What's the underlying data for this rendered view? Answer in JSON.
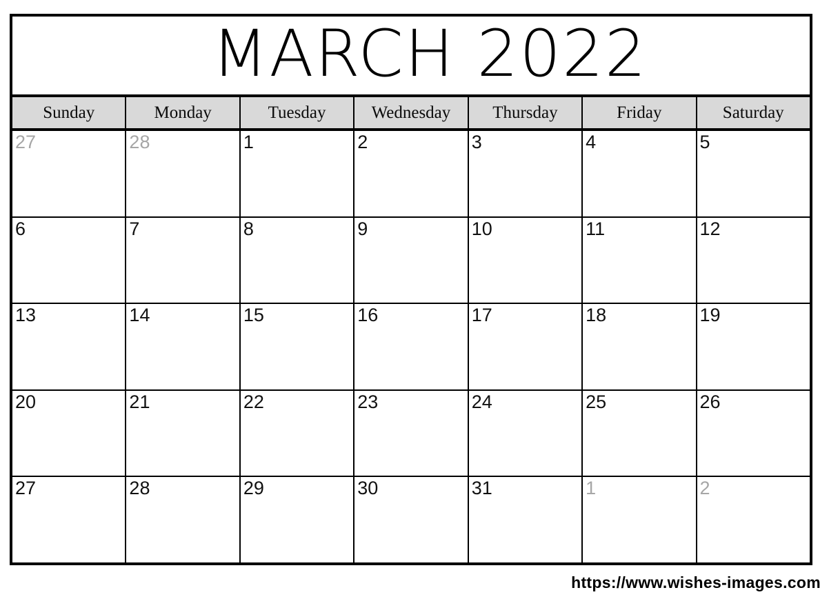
{
  "calendar": {
    "title": "MARCH 2022",
    "month": "MARCH",
    "year": "2022",
    "colors": {
      "header_background": "#d9d9d9",
      "border": "#000000",
      "day_text": "#111111",
      "muted_day_text": "#a6a6a6",
      "page_background": "#ffffff"
    },
    "weekdays": [
      {
        "label": "Sunday"
      },
      {
        "label": "Monday"
      },
      {
        "label": "Tuesday"
      },
      {
        "label": "Wednesday"
      },
      {
        "label": "Thursday"
      },
      {
        "label": "Friday"
      },
      {
        "label": "Saturday"
      }
    ],
    "weeks": [
      {
        "days": [
          {
            "number": "27",
            "muted": true
          },
          {
            "number": "28",
            "muted": true
          },
          {
            "number": "1",
            "muted": false
          },
          {
            "number": "2",
            "muted": false
          },
          {
            "number": "3",
            "muted": false
          },
          {
            "number": "4",
            "muted": false
          },
          {
            "number": "5",
            "muted": false
          }
        ]
      },
      {
        "days": [
          {
            "number": "6",
            "muted": false
          },
          {
            "number": "7",
            "muted": false
          },
          {
            "number": "8",
            "muted": false
          },
          {
            "number": "9",
            "muted": false
          },
          {
            "number": "10",
            "muted": false
          },
          {
            "number": "11",
            "muted": false
          },
          {
            "number": "12",
            "muted": false
          }
        ]
      },
      {
        "days": [
          {
            "number": "13",
            "muted": false
          },
          {
            "number": "14",
            "muted": false
          },
          {
            "number": "15",
            "muted": false
          },
          {
            "number": "16",
            "muted": false
          },
          {
            "number": "17",
            "muted": false
          },
          {
            "number": "18",
            "muted": false
          },
          {
            "number": "19",
            "muted": false
          }
        ]
      },
      {
        "days": [
          {
            "number": "20",
            "muted": false
          },
          {
            "number": "21",
            "muted": false
          },
          {
            "number": "22",
            "muted": false
          },
          {
            "number": "23",
            "muted": false
          },
          {
            "number": "24",
            "muted": false
          },
          {
            "number": "25",
            "muted": false
          },
          {
            "number": "26",
            "muted": false
          }
        ]
      },
      {
        "days": [
          {
            "number": "27",
            "muted": false
          },
          {
            "number": "28",
            "muted": false
          },
          {
            "number": "29",
            "muted": false
          },
          {
            "number": "30",
            "muted": false
          },
          {
            "number": "31",
            "muted": false
          },
          {
            "number": "1",
            "muted": true
          },
          {
            "number": "2",
            "muted": true
          }
        ]
      }
    ]
  },
  "footer": {
    "url": "https://www.wishes-images.com"
  }
}
